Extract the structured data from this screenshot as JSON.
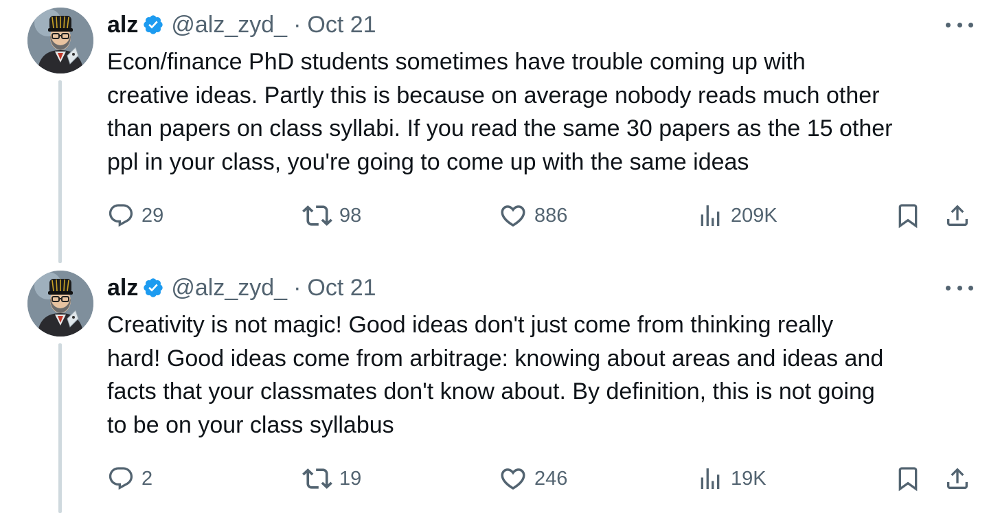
{
  "tweets": [
    {
      "author": {
        "name": "alz",
        "handle": "@alz_zyd_",
        "verified": true
      },
      "separator": "·",
      "date": "Oct 21",
      "text": "Econ/finance PhD students sometimes have trouble coming up with\ncreative ideas. Partly this is because on average nobody reads much other\nthan papers on class syllabi. If you read the same 30 papers as the 15 other\nppl in your class, you're going to come up with the same ideas",
      "stats": {
        "replies": "29",
        "retweets": "98",
        "likes": "886",
        "views": "209K"
      }
    },
    {
      "author": {
        "name": "alz",
        "handle": "@alz_zyd_",
        "verified": true
      },
      "separator": "·",
      "date": "Oct 21",
      "text": "Creativity is not magic! Good ideas don't just come from thinking really\nhard! Good ideas come from arbitrage: knowing about areas and ideas and\nfacts that your classmates don't know about. By definition, this is not going\nto be on your class syllabus",
      "stats": {
        "replies": "2",
        "retweets": "19",
        "likes": "246",
        "views": "19K"
      }
    }
  ],
  "icons": {
    "reply": "reply-icon",
    "retweet": "retweet-icon",
    "like": "heart-icon",
    "views": "views-chart-icon",
    "bookmark": "bookmark-icon",
    "share": "share-icon",
    "more": "more-dots-icon",
    "verified": "verified-badge-icon"
  },
  "colors": {
    "text_primary": "#0f1419",
    "text_secondary": "#536471",
    "verified_blue": "#1d9bf0",
    "thread_line": "#cfd9de",
    "background": "#ffffff"
  }
}
